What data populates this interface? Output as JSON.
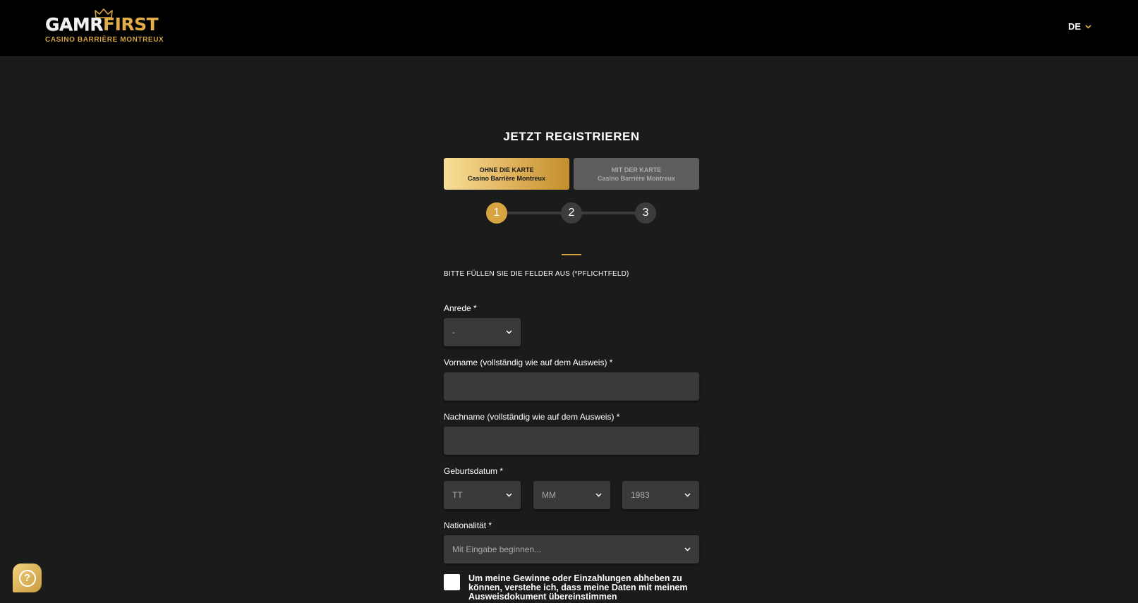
{
  "header": {
    "logo": {
      "part1": "GAMR",
      "part2": "FIRST",
      "subtitle": "CASINO BARRIÈRE MONTREUX"
    },
    "language": "DE"
  },
  "registration": {
    "title": "JETZT REGISTRIEREN",
    "card_tabs": [
      {
        "line1": "OHNE DIE KARTE",
        "line2": "Casino Barrière Montreux",
        "active": true
      },
      {
        "line1": "MIT DER KARTE",
        "line2": "Casino Barrière Montreux",
        "active": false
      }
    ],
    "steps": [
      "1",
      "2",
      "3"
    ],
    "current_step": 1,
    "instructions": "BITTE FÜLLEN SIE DIE FELDER AUS (*PFLICHTFELD)",
    "fields": {
      "salutation": {
        "label": "Anrede *",
        "value": "-"
      },
      "first_name": {
        "label": "Vorname (vollständig wie auf dem Ausweis) *",
        "value": ""
      },
      "last_name": {
        "label": "Nachname (vollständig wie auf dem Ausweis) *",
        "value": ""
      },
      "birthdate": {
        "label": "Geburtsdatum *",
        "day": "TT",
        "month": "MM",
        "year": "1983"
      },
      "nationality": {
        "label": "Nationalität *",
        "placeholder": "Mit Eingabe beginnen..."
      }
    },
    "consent_text": "Um meine Gewinne oder Einzahlungen abheben zu können, verstehe ich, dass meine Daten mit meinem Ausweisdokument übereinstimmen"
  },
  "help": {
    "label": "?"
  },
  "colors": {
    "accent": "#d6a441",
    "background": "#1b1b1b",
    "field": "#3a3a3a",
    "header": "#000000"
  }
}
